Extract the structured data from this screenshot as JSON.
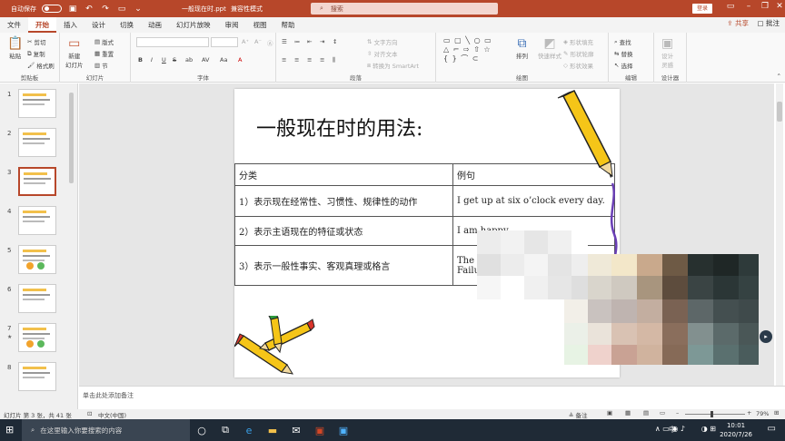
{
  "titlebar": {
    "autosave_label": "自动保存",
    "autosave_state": "关",
    "document_name": "一般现在时.ppt",
    "mode": "兼容性模式",
    "search_placeholder": "搜索",
    "login_label": "登录"
  },
  "tabs": [
    "文件",
    "开始",
    "插入",
    "设计",
    "切换",
    "动画",
    "幻灯片放映",
    "审阅",
    "视图",
    "帮助"
  ],
  "active_tab": "开始",
  "share_label": "共享",
  "comment_label": "批注",
  "ribbon": {
    "clipboard": {
      "paste": "粘贴",
      "cut": "剪切",
      "copy": "复制",
      "format_painter": "格式刷",
      "label": "剪贴板"
    },
    "slides": {
      "new_slide": "新建\n幻灯片",
      "layout": "版式",
      "reset": "重置",
      "section": "节",
      "label": "幻灯片"
    },
    "font": {
      "label": "字体",
      "bold": "B",
      "italic": "I",
      "underline": "U",
      "strike": "S",
      "shadow": "ab",
      "spacing": "AV",
      "case": "Aa"
    },
    "paragraph": {
      "text_direction": "文字方向",
      "align_text": "对齐文本",
      "smartart": "转换为 SmartArt",
      "label": "段落"
    },
    "drawing": {
      "arrange": "排列",
      "quick_styles": "快速样式",
      "shape_fill": "形状填充",
      "shape_outline": "形状轮廓",
      "shape_effects": "形状效果",
      "label": "绘图"
    },
    "editing": {
      "find": "查找",
      "replace": "替换",
      "select": "选择",
      "label": "编辑"
    },
    "designer": {
      "design_ideas": "设计\n灵感",
      "label": "设计器"
    }
  },
  "thumbnails": [
    {
      "num": "1",
      "star": false
    },
    {
      "num": "2",
      "star": false
    },
    {
      "num": "3",
      "star": false,
      "selected": true
    },
    {
      "num": "4",
      "star": false
    },
    {
      "num": "5",
      "star": false
    },
    {
      "num": "6",
      "star": false
    },
    {
      "num": "7",
      "star": true
    },
    {
      "num": "8",
      "star": false
    }
  ],
  "slide": {
    "title": "一般现在时的用法:",
    "table": {
      "headers": [
        "分类",
        "例句"
      ],
      "rows": [
        [
          "1）表示现在经常性、习惯性、规律性的动作",
          "I get up at six o’clock every day."
        ],
        [
          "2）表示主语现在的特征或状态",
          "I am happy."
        ],
        [
          "3）表示一般性事实、客观真理或格言",
          "The e\nFailu"
        ]
      ]
    }
  },
  "notes_placeholder": "单击此处添加备注",
  "statusbar": {
    "slide_info": "幻灯片 第 3 张，共 41 张",
    "language": "中文(中国)",
    "notes_btn": "备注",
    "zoom": "79%"
  },
  "taskbar": {
    "search_placeholder": "在这里输入你要搜索的内容",
    "time": "10:01",
    "date": "2020/7/26",
    "ime": "中"
  },
  "colors": {
    "accent": "#b7472a",
    "pencil_yellow": "#f5c518",
    "pencil_purple": "#6a3fb5"
  }
}
